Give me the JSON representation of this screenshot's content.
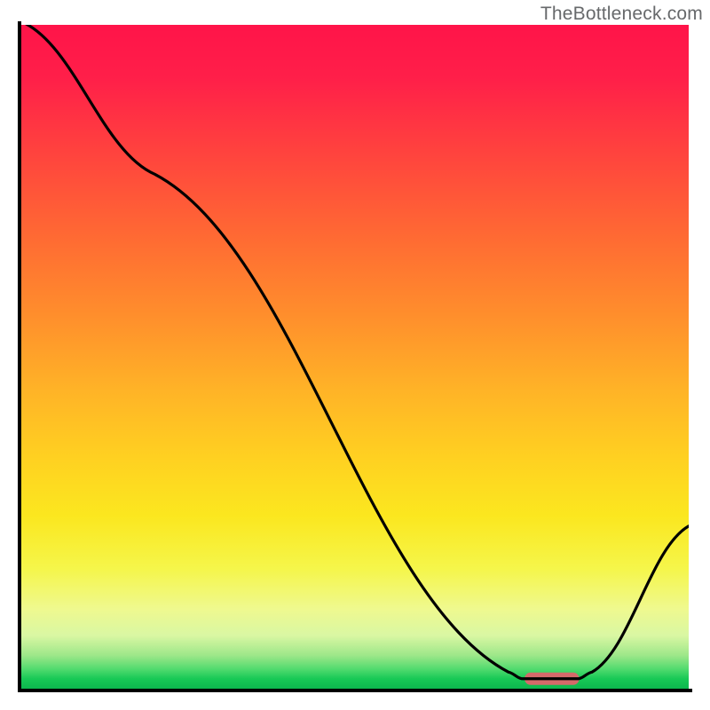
{
  "watermark": "TheBottleneck.com",
  "chart_data": {
    "type": "line",
    "title": "",
    "xlabel": "",
    "ylabel": "",
    "categories_note": "x and y are normalized 0–1 (0,0 at bottom-left of plot area)",
    "xlim": [
      0,
      1
    ],
    "ylim": [
      0,
      1
    ],
    "series": [
      {
        "name": "curve",
        "points": [
          {
            "x": 0.0,
            "y": 1.005
          },
          {
            "x": 0.2,
            "y": 0.775
          },
          {
            "x": 0.73,
            "y": 0.025
          },
          {
            "x": 0.75,
            "y": 0.015
          },
          {
            "x": 0.835,
            "y": 0.015
          },
          {
            "x": 0.855,
            "y": 0.025
          },
          {
            "x": 1.0,
            "y": 0.245
          }
        ]
      }
    ],
    "marker": {
      "name": "highlight-pill",
      "x_center": 0.795,
      "y": 0.015,
      "width": 0.082,
      "color": "#d46a6a"
    },
    "gradient_stops": [
      {
        "pos": 0.0,
        "color": "#ff1449"
      },
      {
        "pos": 0.5,
        "color": "#ffb327"
      },
      {
        "pos": 0.8,
        "color": "#f5f64b"
      },
      {
        "pos": 1.0,
        "color": "#0db74e"
      }
    ]
  }
}
